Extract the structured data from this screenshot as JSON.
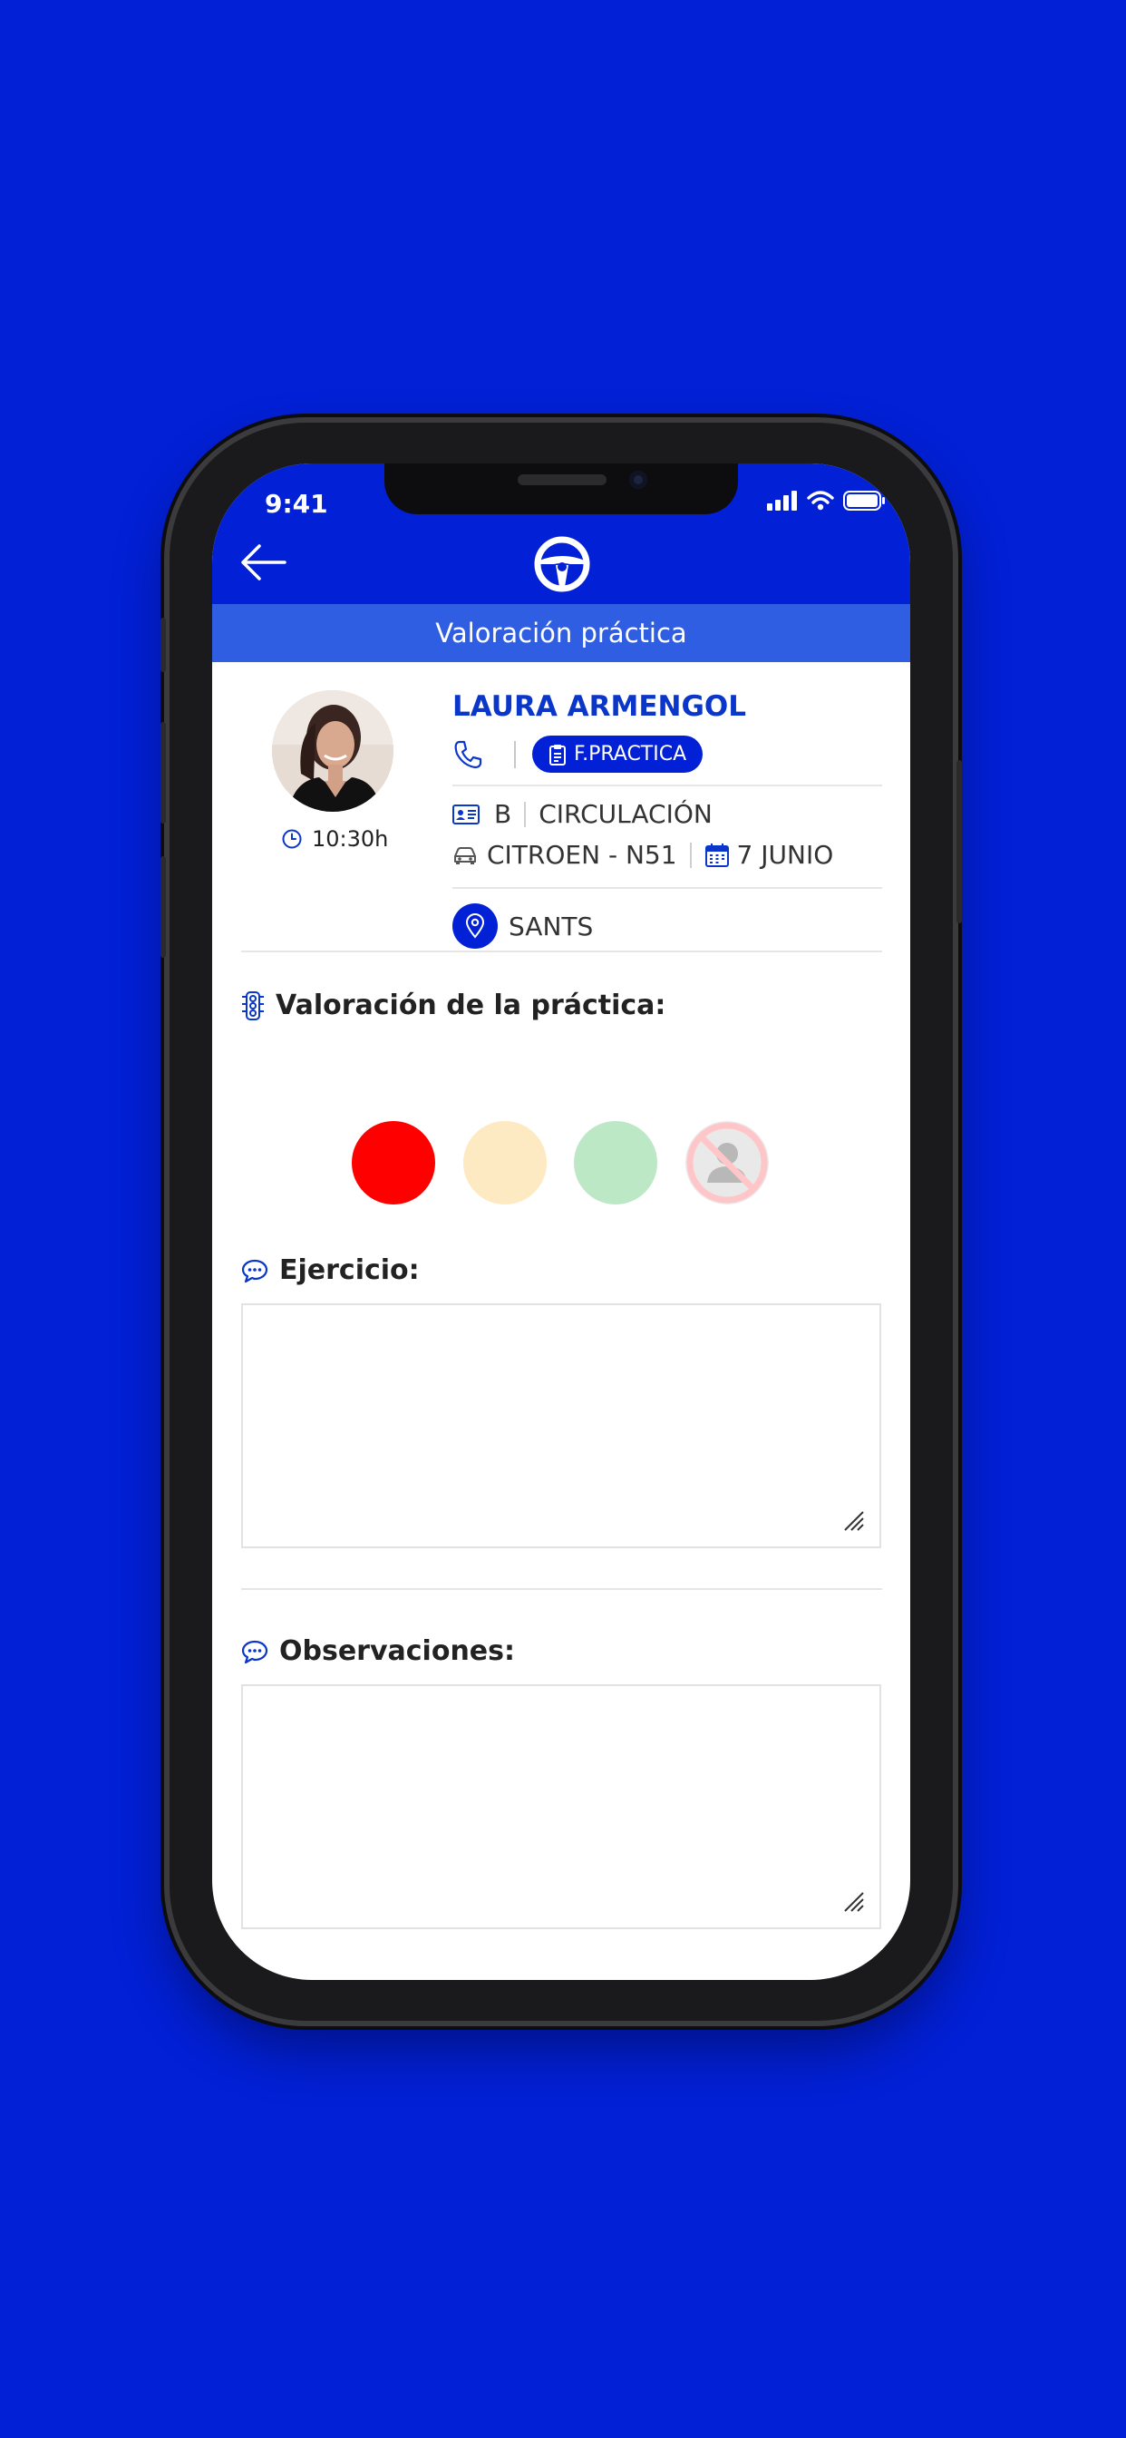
{
  "status_bar": {
    "time": "9:41"
  },
  "app_bar": {
    "back_icon": "arrow-left-icon",
    "logo_icon": "steering-wheel-icon"
  },
  "page_title": "Valoración práctica",
  "student": {
    "name": "LAURA ARMENGOL",
    "time": "10:30h",
    "type_badge": "F.PRACTICA",
    "license": "B",
    "category": "CIRCULACIÓN",
    "vehicle": "CITROEN - N51",
    "date": "7 JUNIO",
    "location": "SANTS"
  },
  "evaluation": {
    "label": "Valoración de la práctica:",
    "options": [
      {
        "name": "red",
        "color": "#ff0000"
      },
      {
        "name": "yellow",
        "color": "#fde9c2"
      },
      {
        "name": "green",
        "color": "#bde8c6"
      },
      {
        "name": "absent",
        "color": "#e7e7e7"
      }
    ]
  },
  "exercise": {
    "label": "Ejercicio:",
    "value": ""
  },
  "observations": {
    "label": "Observaciones:",
    "value": ""
  },
  "colors": {
    "brand": "#0220d6",
    "title_bar": "#2f5ee3",
    "name": "#0a36c9"
  }
}
